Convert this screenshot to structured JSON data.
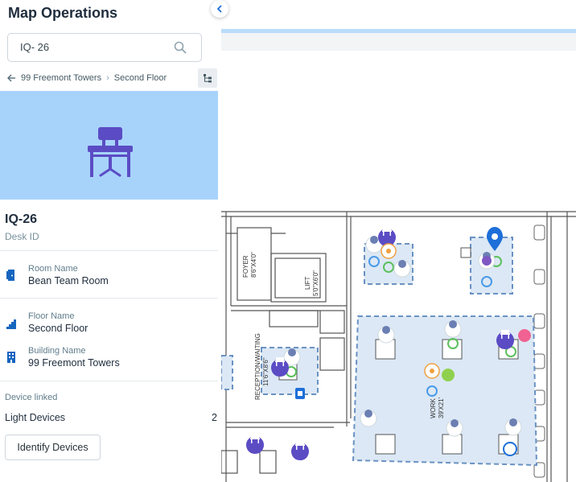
{
  "app": {
    "title": "Map Operations"
  },
  "search": {
    "value": "IQ- 26",
    "icon": "search-icon"
  },
  "breadcrumb": {
    "items": [
      "99 Freemont Towers",
      "Second Floor"
    ]
  },
  "desk": {
    "title": "IQ-26",
    "subtitle": "Desk ID",
    "hero_color": "#a7d3fb",
    "icon_color": "#5b4cc4"
  },
  "details": [
    {
      "label": "Room Name",
      "value": "Bean Team Room",
      "icon": "door-icon"
    },
    {
      "label": "Floor Name",
      "value": "Second Floor",
      "icon": "stairs-icon"
    },
    {
      "label": "Building Name",
      "value": "99 Freemont Towers",
      "icon": "building-icon"
    }
  ],
  "devices": {
    "section_label": "Device linked",
    "light_label": "Light Devices",
    "light_count": "2",
    "identify_label": "Identify Devices"
  },
  "map": {
    "labels": {
      "foyer": "FOYER",
      "foyer_size": "8'6\"X4'0\"",
      "lift": "LIFT",
      "lift_size": "5'0\"X6'0\"",
      "reception": "RECEPTION/WAITING",
      "reception_size": "11'6\"X8'6\"",
      "work": "WORK",
      "work_size": "39'X21'"
    },
    "accent_color": "#5b4cc4",
    "zone_fill": "#dce8f5",
    "zone_stroke": "#6a92c2"
  }
}
